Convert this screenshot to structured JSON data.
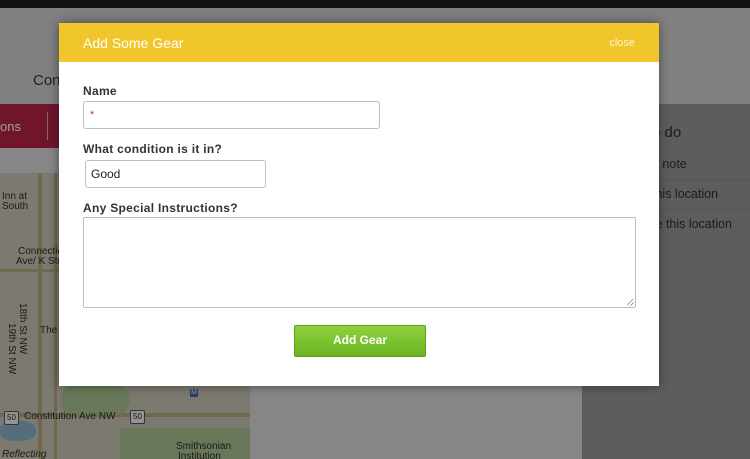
{
  "background": {
    "nav_text": "Con",
    "redbar_text": "ons",
    "right_panel": {
      "heading": "o do",
      "items": [
        "a note",
        "this location",
        "te this location"
      ]
    },
    "map_labels": {
      "inn": "Inn at",
      "south": "South",
      "connecticut": "Connectic",
      "ave_k": "Ave/ K Str",
      "st18": "18th St NW",
      "st19": "19th St NW",
      "the": "The",
      "constitution": "Constitution Ave NW",
      "smithsonian": "Smithsonian",
      "institution": "Institution",
      "reflecting": "Reflecting",
      "shield_50": "50",
      "metro": "M"
    }
  },
  "modal": {
    "title": "Add Some Gear",
    "close_label": "close",
    "name_label": "Name",
    "name_value": "",
    "name_required_marker": "*",
    "condition_label": "What condition is it in?",
    "condition_value": "Good",
    "instructions_label": "Any Special Instructions?",
    "instructions_value": "",
    "submit_label": "Add Gear"
  },
  "colors": {
    "header": "#f0c62b",
    "submit": "#7cc22f",
    "accent_bar": "#b3254a"
  }
}
